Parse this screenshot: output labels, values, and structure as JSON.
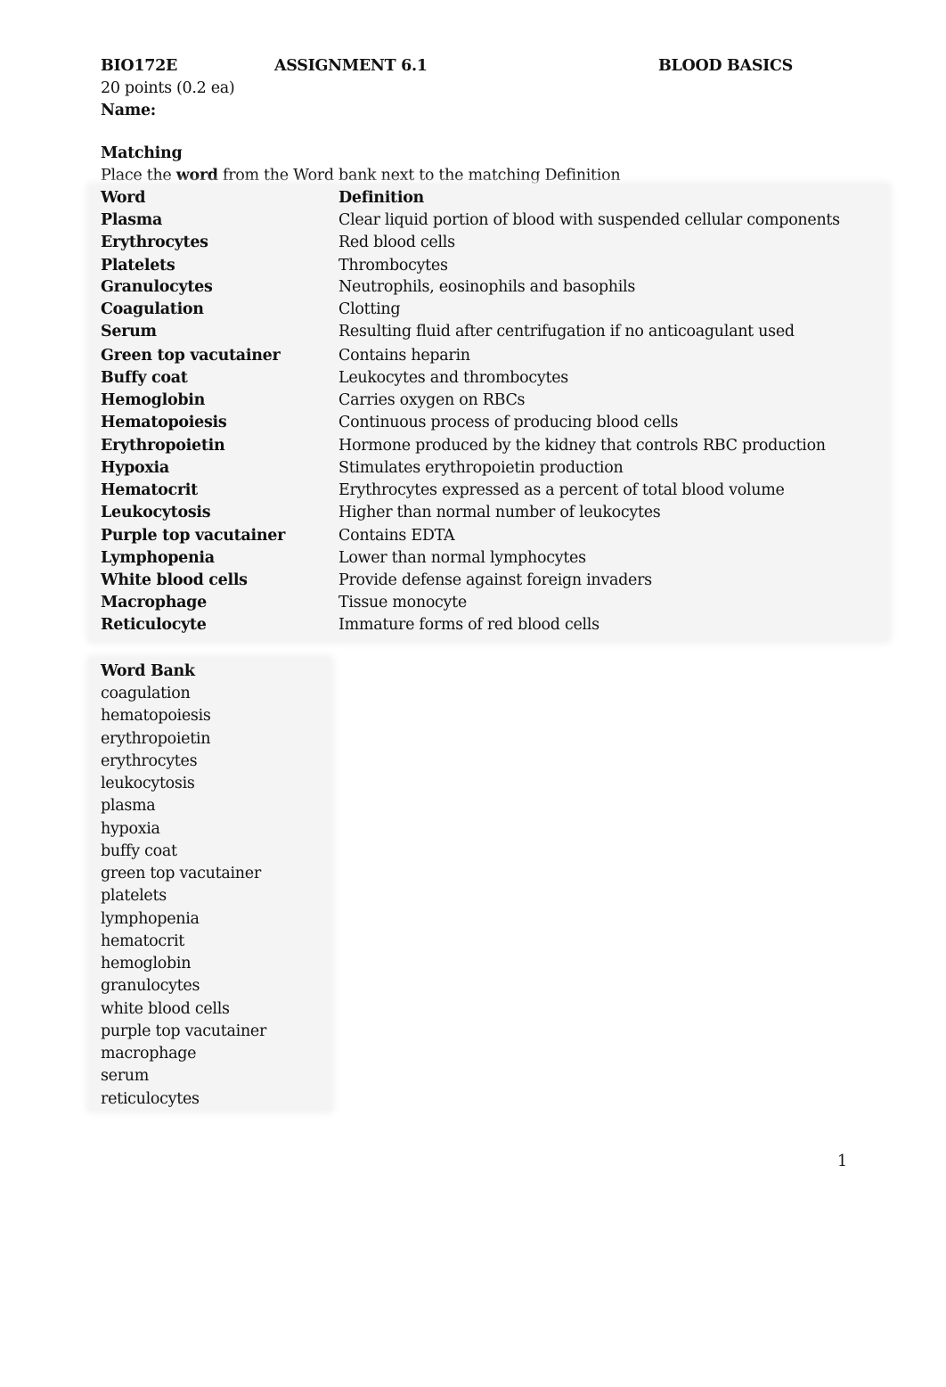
{
  "header": {
    "course": "BIO172E",
    "assignment": "ASSIGNMENT 6.1",
    "title": "BLOOD BASICS",
    "points": "20  points (0.2 ea)",
    "name_label": "Name:"
  },
  "section": {
    "heading": "Matching",
    "instructions_pre": "Place the ",
    "instructions_bold": "word",
    "instructions_post": " from the Word bank next to the matching Definition"
  },
  "table": {
    "columns": [
      "Word",
      "Definition"
    ],
    "rows": [
      {
        "word": "Plasma",
        "definition": "Clear liquid portion of blood with suspended cellular components"
      },
      {
        "word": "Erythrocytes",
        "definition": "Red blood cells"
      },
      {
        "word": "Platelets",
        "definition": "Thrombocytes"
      },
      {
        "word": "Granulocytes",
        "definition": "Neutrophils, eosinophils and basophils"
      },
      {
        "word": "Coagulation",
        "definition": "Clotting"
      },
      {
        "word": "Serum",
        "definition": "Resulting fluid after centrifugation if no anticoagulant used"
      },
      {
        "word": "Green top vacutainer",
        "definition": "Contains heparin"
      },
      {
        "word": "Buffy coat",
        "definition": "Leukocytes and thrombocytes"
      },
      {
        "word": "Hemoglobin",
        "definition": "Carries oxygen on RBCs"
      },
      {
        "word": "Hematopoiesis",
        "definition": "Continuous process of producing  blood cells"
      },
      {
        "word": "Erythropoietin",
        "definition": "Hormone produced by the kidney that controls RBC production"
      },
      {
        "word": "Hypoxia",
        "definition": "Stimulates erythropoietin production"
      },
      {
        "word": "Hematocrit",
        "definition": "Erythrocytes expressed as a percent of total blood volume"
      },
      {
        "word": "Leukocytosis",
        "definition": "Higher than normal number of leukocytes"
      },
      {
        "word": "Purple top vacutainer",
        "definition": "Contains EDTA"
      },
      {
        "word": "Lymphopenia",
        "definition": "Lower than normal lymphocytes"
      },
      {
        "word": "White blood cells",
        "definition": "Provide defense against foreign invaders"
      },
      {
        "word": "Macrophage",
        "definition": "Tissue monocyte"
      },
      {
        "word": "Reticulocyte",
        "definition": "Immature forms of red blood cells"
      }
    ]
  },
  "word_bank": {
    "heading": "Word Bank",
    "items": [
      "coagulation",
      "hematopoiesis",
      "erythropoietin",
      "erythrocytes",
      "leukocytosis",
      "plasma",
      "hypoxia",
      "buffy coat",
      "green top vacutainer",
      "platelets",
      "lymphopenia",
      "hematocrit",
      "hemoglobin",
      "granulocytes",
      "white blood cells",
      "purple top vacutainer",
      "macrophage",
      "serum",
      "reticulocytes"
    ]
  },
  "footer": {
    "page_number": "1"
  }
}
